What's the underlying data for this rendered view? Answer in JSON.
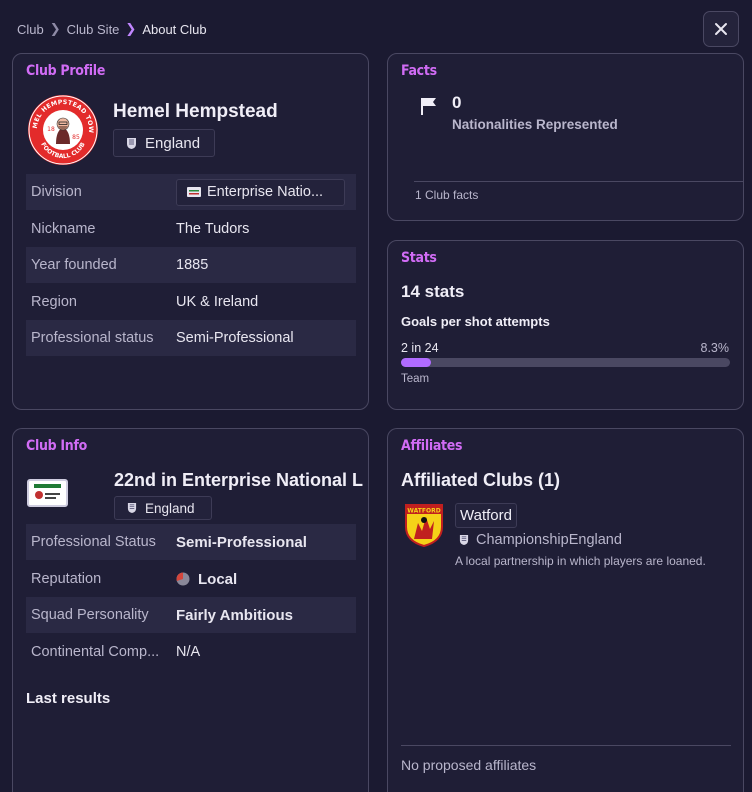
{
  "breadcrumb": {
    "items": [
      "Club",
      "Club Site"
    ],
    "current": "About Club"
  },
  "profile": {
    "section_title": "Club Profile",
    "club_name": "Hemel Hempstead",
    "nation": "England",
    "badge_text": {
      "top": "HEMEL HEMPSTEAD TOWN",
      "bottom": "FOOTBALL CLUB",
      "year_left": "18",
      "year_right": "85"
    },
    "rows": [
      {
        "key": "Division",
        "value": "Enterprise Natio..."
      },
      {
        "key": "Nickname",
        "value": "The Tudors"
      },
      {
        "key": "Year founded",
        "value": "1885"
      },
      {
        "key": "Region",
        "value": "UK & Ireland"
      },
      {
        "key": "Professional status",
        "value": "Semi-Professional"
      }
    ]
  },
  "facts": {
    "section_title": "Facts",
    "value": "0",
    "label": "Nationalities Represented",
    "footer": "1 Club facts"
  },
  "stats": {
    "section_title": "Stats",
    "count_text": "14 stats",
    "stat_name": "Goals per shot attempts",
    "left_value": "2 in 24",
    "right_value": "8.3%",
    "bar_fraction": 0.083,
    "sub_label": "Team",
    "bar_color": "#b06bff"
  },
  "club_info": {
    "section_title": "Club Info",
    "position_text": "22nd in Enterprise National L",
    "nation": "England",
    "rows": [
      {
        "key": "Professional Status",
        "value": "Semi-Professional"
      },
      {
        "key": "Reputation",
        "value": "Local"
      },
      {
        "key": "Squad Personality",
        "value": "Fairly Ambitious"
      },
      {
        "key": "Continental Comp...",
        "value": "N/A"
      }
    ],
    "last_results_title": "Last results"
  },
  "affiliates": {
    "section_title": "Affiliates",
    "heading": "Affiliated Clubs (1)",
    "club_name": "Watford",
    "league": "Championship",
    "nation": "England",
    "description": "A local partnership in which players are loaned.",
    "footer": "No proposed affiliates"
  },
  "colors": {
    "accent": "#d16cf5",
    "background": "#1b1a31",
    "panel": "#1f1e36",
    "border": "#4a4862"
  }
}
